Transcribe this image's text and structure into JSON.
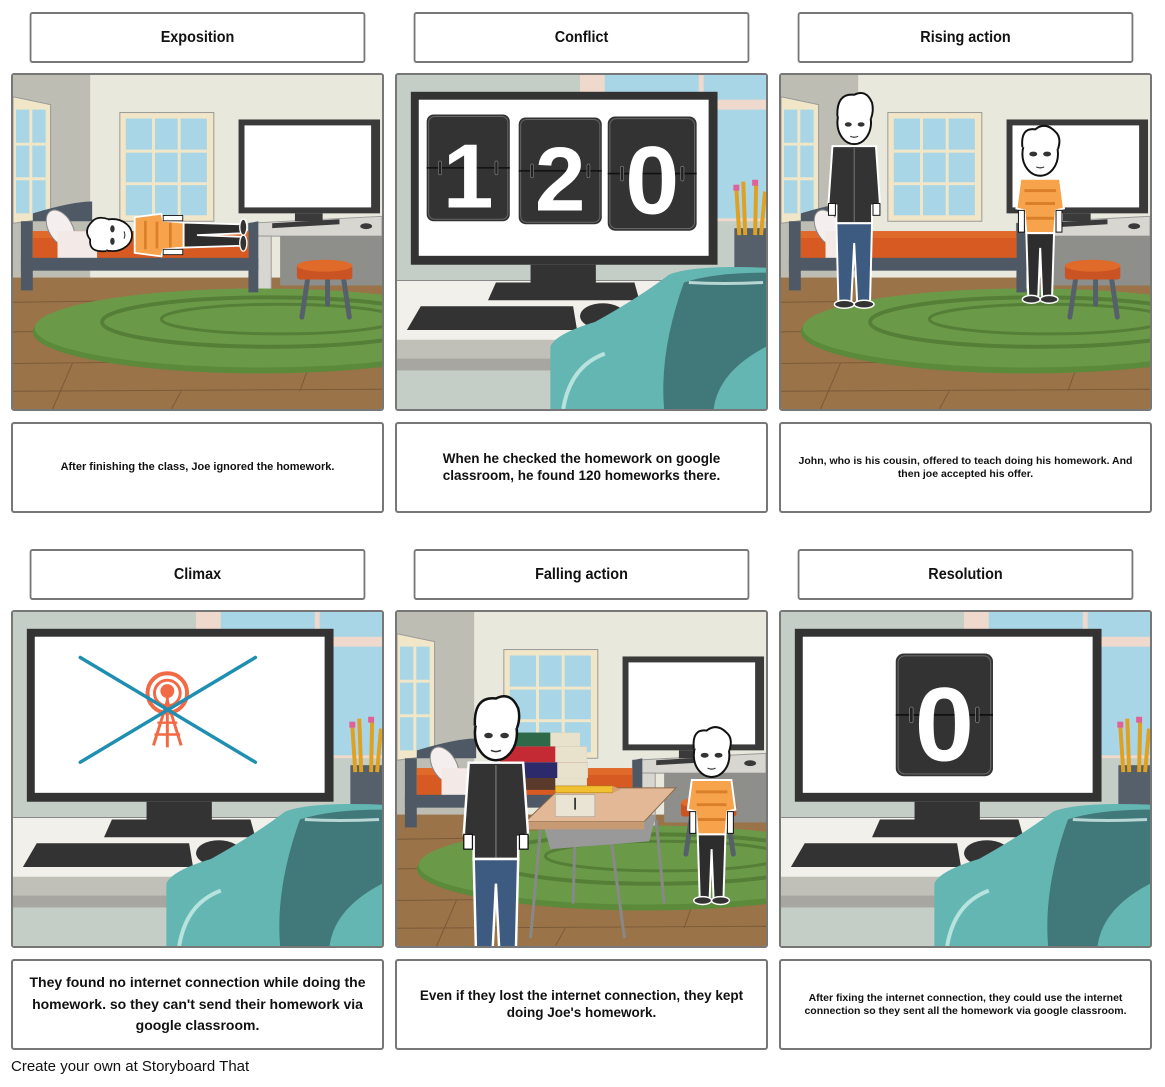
{
  "storyboard": {
    "cells": [
      {
        "title": "Exposition",
        "caption": "After finishing the class, Joe ignored the homework.",
        "scene": "bedroom-joe-lying-on-bed"
      },
      {
        "title": "Conflict",
        "caption": "When he checked the homework on google classroom, he found 120 homeworks there.",
        "scene": "computer-flip-counter",
        "counter_digits": [
          "1",
          "2",
          "0"
        ]
      },
      {
        "title": "Rising action",
        "caption": "John, who is his cousin, offered to teach doing his homework. And then joe accepted his offer.",
        "scene": "bedroom-john-and-joe-standing"
      },
      {
        "title": "Climax",
        "caption": "They found no internet connection while doing the homework. so they can't send their homework via google classroom.",
        "scene": "computer-no-signal",
        "icon": "crossed-out-signal-tower-icon"
      },
      {
        "title": "Falling action",
        "caption": "Even if they lost the internet connection, they kept doing Joe's homework.",
        "scene": "bedroom-desk-with-books"
      },
      {
        "title": "Resolution",
        "caption": "After fixing the internet connection, they could use the internet connection so they sent all the homework via google classroom.",
        "scene": "computer-flip-counter",
        "counter_digits": [
          "0"
        ]
      }
    ]
  },
  "footer": {
    "text": "Create your own at Storyboard That"
  },
  "colors": {
    "border": "#777777",
    "signal_orange": "#f26a45",
    "cross_teal": "#1e8fb0",
    "chair_teal": "#4b9a96",
    "rug_green": "#6a9a48",
    "floor_brown": "#9a7348",
    "bed_orange": "#d65a22"
  }
}
